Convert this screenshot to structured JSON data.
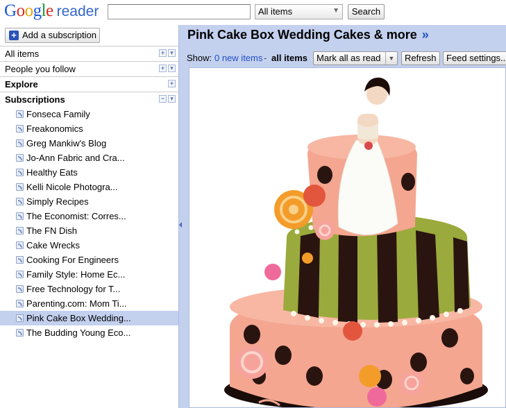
{
  "app": {
    "logo_word": "Google",
    "logo_product": "reader"
  },
  "search": {
    "query": "",
    "scope_selected": "All items",
    "button_label": "Search"
  },
  "nav": {
    "add_subscription_label": "Add a subscription",
    "sections": [
      {
        "label": "All items"
      },
      {
        "label": "People you follow"
      },
      {
        "label": "Explore"
      },
      {
        "label": "Subscriptions"
      }
    ],
    "subscriptions": [
      {
        "label": "Fonseca Family"
      },
      {
        "label": "Freakonomics"
      },
      {
        "label": "Greg Mankiw's Blog"
      },
      {
        "label": "Jo-Ann Fabric and Cra..."
      },
      {
        "label": "Healthy Eats"
      },
      {
        "label": "Kelli Nicole Photogra..."
      },
      {
        "label": "Simply Recipes"
      },
      {
        "label": "The Economist: Corres..."
      },
      {
        "label": "The FN Dish"
      },
      {
        "label": "Cake Wrecks"
      },
      {
        "label": "Cooking For Engineers"
      },
      {
        "label": "Family Style: Home Ec..."
      },
      {
        "label": "Free Technology for T..."
      },
      {
        "label": "Parenting.com: Mom Ti..."
      },
      {
        "label": "Pink Cake Box Wedding..."
      },
      {
        "label": "The Budding Young Eco..."
      }
    ],
    "selected_subscription": "Pink Cake Box Wedding..."
  },
  "main": {
    "feed_title": "Pink Cake Box Wedding Cakes & more",
    "feed_title_more": "»",
    "show_label": "Show:",
    "new_items_link": "0 new items",
    "separator": "-",
    "all_items_label": "all items",
    "mark_all_read_label": "Mark all as read",
    "refresh_label": "Refresh",
    "feed_settings_label": "Feed settings..."
  },
  "colors": {
    "selection": "#c3d0ee",
    "link": "#2250c6",
    "cake_pink": "#f4a690",
    "cake_green": "#9aaa3c",
    "cake_dark": "#2a1410"
  }
}
